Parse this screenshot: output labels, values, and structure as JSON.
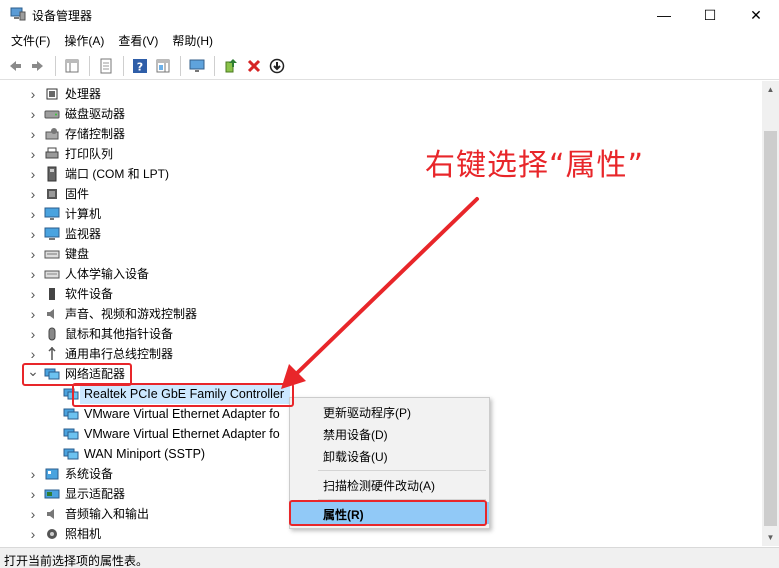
{
  "window": {
    "title": "设备管理器",
    "min_glyph": "—",
    "max_glyph": "☐",
    "close_glyph": "✕"
  },
  "menu": [
    "文件(F)",
    "操作(A)",
    "查看(V)",
    "帮助(H)"
  ],
  "tree": {
    "categories_top": [
      {
        "label": "处理器",
        "icon": "processor-icon"
      },
      {
        "label": "磁盘驱动器",
        "icon": "disk-drive-icon"
      },
      {
        "label": "存储控制器",
        "icon": "storage-controller-icon"
      },
      {
        "label": "打印队列",
        "icon": "print-queue-icon"
      },
      {
        "label": "端口 (COM 和 LPT)",
        "icon": "port-icon"
      },
      {
        "label": "固件",
        "icon": "firmware-icon"
      },
      {
        "label": "计算机",
        "icon": "computer-icon"
      },
      {
        "label": "监视器",
        "icon": "monitor-icon"
      },
      {
        "label": "键盘",
        "icon": "keyboard-icon"
      },
      {
        "label": "人体学输入设备",
        "icon": "hid-icon"
      },
      {
        "label": "软件设备",
        "icon": "software-device-icon"
      },
      {
        "label": "声音、视频和游戏控制器",
        "icon": "sound-icon"
      },
      {
        "label": "鼠标和其他指针设备",
        "icon": "mouse-icon"
      },
      {
        "label": "通用串行总线控制器",
        "icon": "usb-icon"
      }
    ],
    "network_label": "网络适配器",
    "network_children": [
      "Realtek PCIe GbE Family Controller",
      "VMware Virtual Ethernet Adapter fo",
      "VMware Virtual Ethernet Adapter fo",
      "WAN Miniport (SSTP)"
    ],
    "categories_bottom": [
      {
        "label": "系统设备",
        "icon": "system-device-icon"
      },
      {
        "label": "显示适配器",
        "icon": "display-adapter-icon"
      },
      {
        "label": "音频输入和输出",
        "icon": "audio-io-icon"
      },
      {
        "label": "照相机",
        "icon": "camera-icon"
      }
    ]
  },
  "context_menu": {
    "update_driver": "更新驱动程序(P)",
    "disable": "禁用设备(D)",
    "uninstall": "卸载设备(U)",
    "scan": "扫描检测硬件改动(A)",
    "properties": "属性(R)"
  },
  "annotation": {
    "text": "右键选择“属性”",
    "color": "#e8262a"
  },
  "status": "打开当前选择项的属性表。",
  "colors": {
    "selection": "#cce8ff",
    "menu_highlight": "#91c9f7",
    "annotation_red": "#e8262a"
  }
}
